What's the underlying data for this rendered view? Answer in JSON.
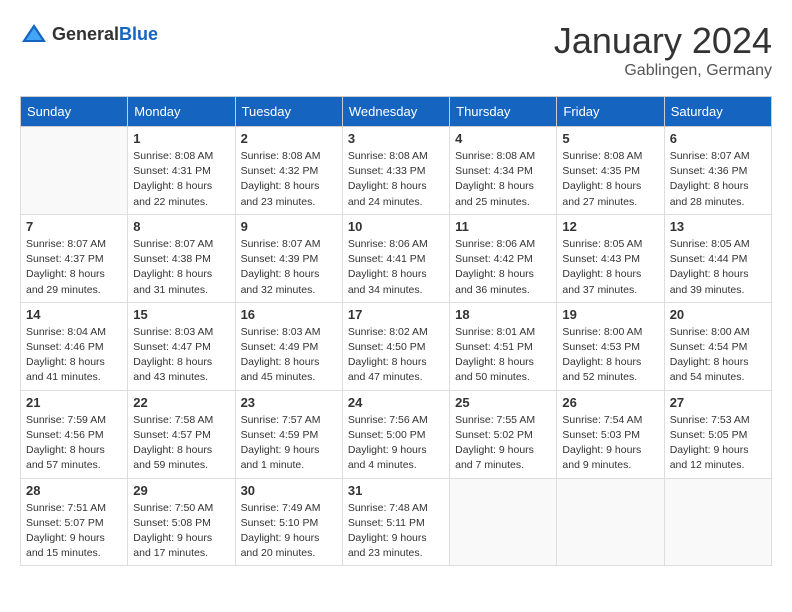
{
  "header": {
    "logo_general": "General",
    "logo_blue": "Blue",
    "month": "January 2024",
    "location": "Gablingen, Germany"
  },
  "weekdays": [
    "Sunday",
    "Monday",
    "Tuesday",
    "Wednesday",
    "Thursday",
    "Friday",
    "Saturday"
  ],
  "weeks": [
    [
      {
        "day": "",
        "empty": true
      },
      {
        "day": "1",
        "sunrise": "Sunrise: 8:08 AM",
        "sunset": "Sunset: 4:31 PM",
        "daylight": "Daylight: 8 hours and 22 minutes."
      },
      {
        "day": "2",
        "sunrise": "Sunrise: 8:08 AM",
        "sunset": "Sunset: 4:32 PM",
        "daylight": "Daylight: 8 hours and 23 minutes."
      },
      {
        "day": "3",
        "sunrise": "Sunrise: 8:08 AM",
        "sunset": "Sunset: 4:33 PM",
        "daylight": "Daylight: 8 hours and 24 minutes."
      },
      {
        "day": "4",
        "sunrise": "Sunrise: 8:08 AM",
        "sunset": "Sunset: 4:34 PM",
        "daylight": "Daylight: 8 hours and 25 minutes."
      },
      {
        "day": "5",
        "sunrise": "Sunrise: 8:08 AM",
        "sunset": "Sunset: 4:35 PM",
        "daylight": "Daylight: 8 hours and 27 minutes."
      },
      {
        "day": "6",
        "sunrise": "Sunrise: 8:07 AM",
        "sunset": "Sunset: 4:36 PM",
        "daylight": "Daylight: 8 hours and 28 minutes."
      }
    ],
    [
      {
        "day": "7",
        "sunrise": "Sunrise: 8:07 AM",
        "sunset": "Sunset: 4:37 PM",
        "daylight": "Daylight: 8 hours and 29 minutes."
      },
      {
        "day": "8",
        "sunrise": "Sunrise: 8:07 AM",
        "sunset": "Sunset: 4:38 PM",
        "daylight": "Daylight: 8 hours and 31 minutes."
      },
      {
        "day": "9",
        "sunrise": "Sunrise: 8:07 AM",
        "sunset": "Sunset: 4:39 PM",
        "daylight": "Daylight: 8 hours and 32 minutes."
      },
      {
        "day": "10",
        "sunrise": "Sunrise: 8:06 AM",
        "sunset": "Sunset: 4:41 PM",
        "daylight": "Daylight: 8 hours and 34 minutes."
      },
      {
        "day": "11",
        "sunrise": "Sunrise: 8:06 AM",
        "sunset": "Sunset: 4:42 PM",
        "daylight": "Daylight: 8 hours and 36 minutes."
      },
      {
        "day": "12",
        "sunrise": "Sunrise: 8:05 AM",
        "sunset": "Sunset: 4:43 PM",
        "daylight": "Daylight: 8 hours and 37 minutes."
      },
      {
        "day": "13",
        "sunrise": "Sunrise: 8:05 AM",
        "sunset": "Sunset: 4:44 PM",
        "daylight": "Daylight: 8 hours and 39 minutes."
      }
    ],
    [
      {
        "day": "14",
        "sunrise": "Sunrise: 8:04 AM",
        "sunset": "Sunset: 4:46 PM",
        "daylight": "Daylight: 8 hours and 41 minutes."
      },
      {
        "day": "15",
        "sunrise": "Sunrise: 8:03 AM",
        "sunset": "Sunset: 4:47 PM",
        "daylight": "Daylight: 8 hours and 43 minutes."
      },
      {
        "day": "16",
        "sunrise": "Sunrise: 8:03 AM",
        "sunset": "Sunset: 4:49 PM",
        "daylight": "Daylight: 8 hours and 45 minutes."
      },
      {
        "day": "17",
        "sunrise": "Sunrise: 8:02 AM",
        "sunset": "Sunset: 4:50 PM",
        "daylight": "Daylight: 8 hours and 47 minutes."
      },
      {
        "day": "18",
        "sunrise": "Sunrise: 8:01 AM",
        "sunset": "Sunset: 4:51 PM",
        "daylight": "Daylight: 8 hours and 50 minutes."
      },
      {
        "day": "19",
        "sunrise": "Sunrise: 8:00 AM",
        "sunset": "Sunset: 4:53 PM",
        "daylight": "Daylight: 8 hours and 52 minutes."
      },
      {
        "day": "20",
        "sunrise": "Sunrise: 8:00 AM",
        "sunset": "Sunset: 4:54 PM",
        "daylight": "Daylight: 8 hours and 54 minutes."
      }
    ],
    [
      {
        "day": "21",
        "sunrise": "Sunrise: 7:59 AM",
        "sunset": "Sunset: 4:56 PM",
        "daylight": "Daylight: 8 hours and 57 minutes."
      },
      {
        "day": "22",
        "sunrise": "Sunrise: 7:58 AM",
        "sunset": "Sunset: 4:57 PM",
        "daylight": "Daylight: 8 hours and 59 minutes."
      },
      {
        "day": "23",
        "sunrise": "Sunrise: 7:57 AM",
        "sunset": "Sunset: 4:59 PM",
        "daylight": "Daylight: 9 hours and 1 minute."
      },
      {
        "day": "24",
        "sunrise": "Sunrise: 7:56 AM",
        "sunset": "Sunset: 5:00 PM",
        "daylight": "Daylight: 9 hours and 4 minutes."
      },
      {
        "day": "25",
        "sunrise": "Sunrise: 7:55 AM",
        "sunset": "Sunset: 5:02 PM",
        "daylight": "Daylight: 9 hours and 7 minutes."
      },
      {
        "day": "26",
        "sunrise": "Sunrise: 7:54 AM",
        "sunset": "Sunset: 5:03 PM",
        "daylight": "Daylight: 9 hours and 9 minutes."
      },
      {
        "day": "27",
        "sunrise": "Sunrise: 7:53 AM",
        "sunset": "Sunset: 5:05 PM",
        "daylight": "Daylight: 9 hours and 12 minutes."
      }
    ],
    [
      {
        "day": "28",
        "sunrise": "Sunrise: 7:51 AM",
        "sunset": "Sunset: 5:07 PM",
        "daylight": "Daylight: 9 hours and 15 minutes."
      },
      {
        "day": "29",
        "sunrise": "Sunrise: 7:50 AM",
        "sunset": "Sunset: 5:08 PM",
        "daylight": "Daylight: 9 hours and 17 minutes."
      },
      {
        "day": "30",
        "sunrise": "Sunrise: 7:49 AM",
        "sunset": "Sunset: 5:10 PM",
        "daylight": "Daylight: 9 hours and 20 minutes."
      },
      {
        "day": "31",
        "sunrise": "Sunrise: 7:48 AM",
        "sunset": "Sunset: 5:11 PM",
        "daylight": "Daylight: 9 hours and 23 minutes."
      },
      {
        "day": "",
        "empty": true
      },
      {
        "day": "",
        "empty": true
      },
      {
        "day": "",
        "empty": true
      }
    ]
  ]
}
